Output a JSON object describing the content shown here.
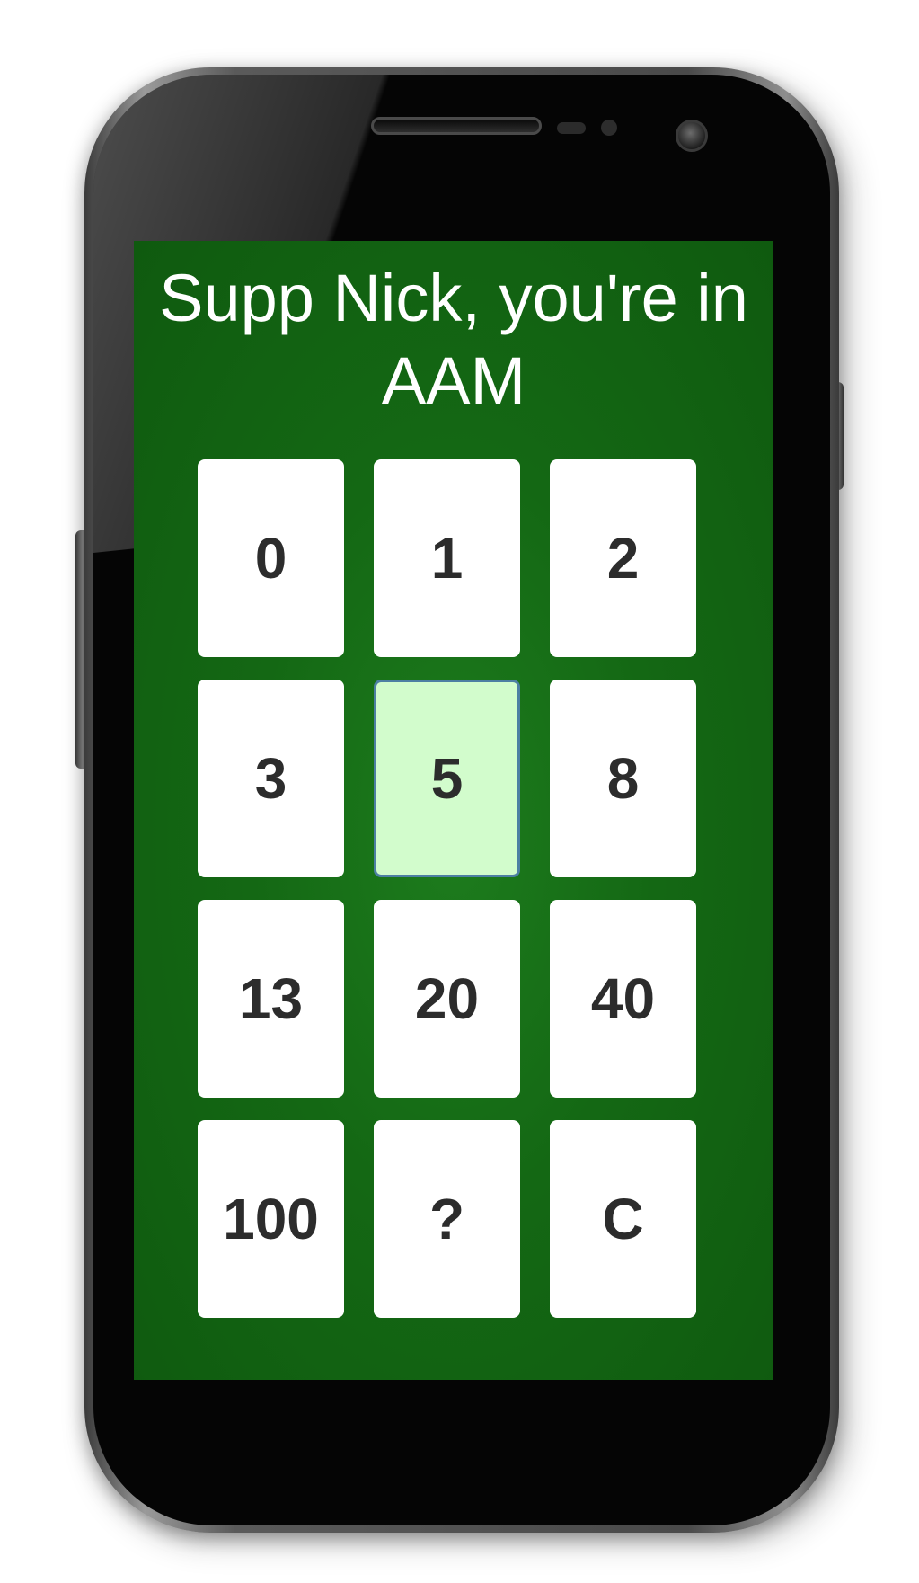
{
  "app": {
    "title": "Supp Nick, you're in AAM"
  },
  "colors": {
    "screen_background": "#146814",
    "card_background": "#ffffff",
    "card_selected_background": "#d2fccc",
    "card_selected_border": "#4d7fa3",
    "card_text": "#2c2c2c",
    "title_text": "#ffffff"
  },
  "cards": [
    {
      "label": "0",
      "selected": false
    },
    {
      "label": "1",
      "selected": false
    },
    {
      "label": "2",
      "selected": false
    },
    {
      "label": "3",
      "selected": false
    },
    {
      "label": "5",
      "selected": true
    },
    {
      "label": "8",
      "selected": false
    },
    {
      "label": "13",
      "selected": false
    },
    {
      "label": "20",
      "selected": false
    },
    {
      "label": "40",
      "selected": false
    },
    {
      "label": "100",
      "selected": false
    },
    {
      "label": "?",
      "selected": false
    },
    {
      "label": "C",
      "selected": false
    }
  ]
}
